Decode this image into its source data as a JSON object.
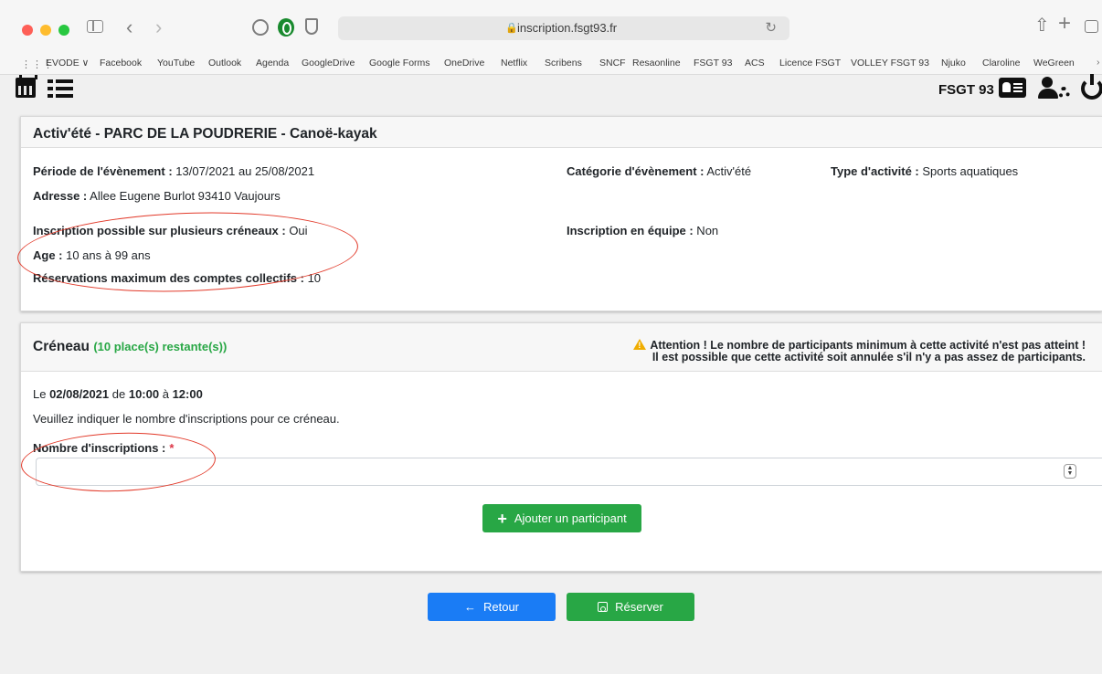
{
  "browser": {
    "url": "inscription.fsgt93.fr",
    "bookmarks": [
      "EVODE ∨",
      "Facebook",
      "YouTube",
      "Outlook",
      "Agenda",
      "GoogleDrive",
      "Google Forms",
      "OneDrive",
      "Netflix",
      "Scribens",
      "SNCF",
      "Resaonline",
      "FSGT 93",
      "ACS",
      "Licence FSGT",
      "VOLLEY FSGT 93",
      "Njuko",
      "Claroline",
      "WeGreen"
    ]
  },
  "header": {
    "brand": "FSGT 93"
  },
  "event": {
    "title": "Activ'été - PARC DE LA POUDRERIE - Canoë-kayak",
    "period_label": "Période de l'évènement :",
    "period_value": " 13/07/2021 au 25/08/2021",
    "address_label": "Adresse :",
    "address_value": " Allee Eugene Burlot 93410 Vaujours",
    "multi_label": "Inscription possible sur plusieurs créneaux :",
    "multi_value": " Oui",
    "age_label": "Age :",
    "age_value": " 10 ans à 99 ans",
    "maxres_label": "Réservations maximum des comptes collectifs :",
    "maxres_value": " 10",
    "category_label": "Catégorie d'évènement :",
    "category_value": " Activ'été",
    "type_label": "Type d'activité :",
    "type_value": " Sports aquatiques",
    "team_label": "Inscription en équipe :",
    "team_value": " Non"
  },
  "slot": {
    "title": "Créneau",
    "remaining": "(10 place(s) restante(s))",
    "warning_line1": "Attention ! Le nombre de participants minimum à cette activité n'est pas atteint !",
    "warning_line2": "Il est possible que cette activité soit annulée s'il n'y a pas assez de participants.",
    "date_prefix": "Le ",
    "date": "02/08/2021",
    "from_word": " de ",
    "start": "10:00",
    "to_word": " à ",
    "end": "12:00",
    "help": "Veuillez indiquer le nombre d'inscriptions pour ce créneau.",
    "field_label": "Nombre d'inscriptions :",
    "required_mark": "*",
    "field_value": "",
    "add_label": "Ajouter un participant"
  },
  "actions": {
    "back_label": "Retour",
    "reserve_label": "Réserver"
  },
  "colors": {
    "success": "#28a745",
    "primary": "#1a7cf5",
    "warning": "#f0ad00",
    "annotation": "#e23a2a"
  }
}
